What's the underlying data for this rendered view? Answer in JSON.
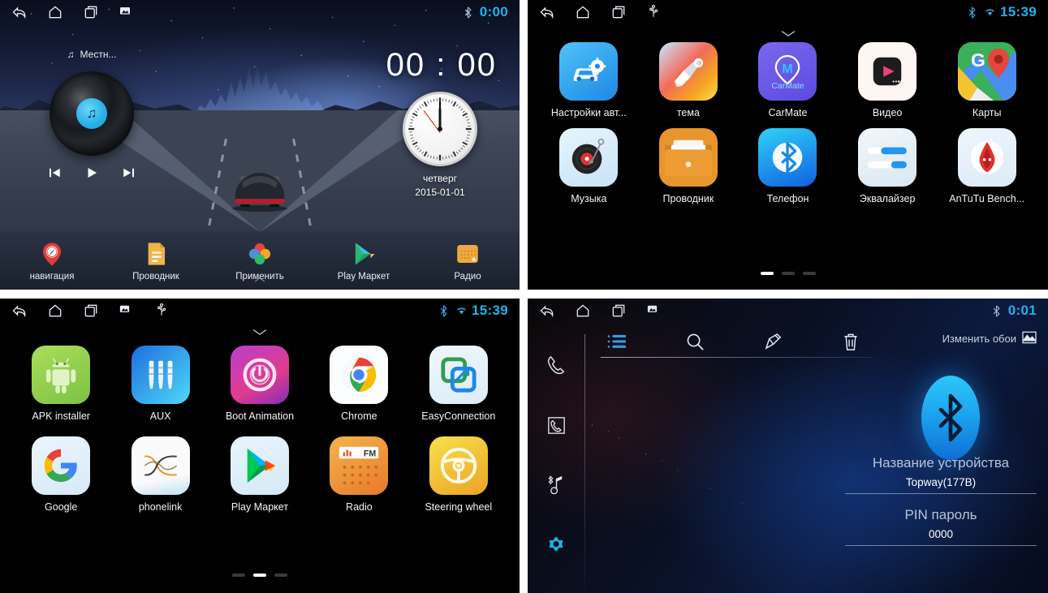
{
  "panels": {
    "home": {
      "name": "Car head unit home screen",
      "statusbar": {
        "icons": [
          "back-icon",
          "home-icon",
          "recents-icon",
          "screenshot-icon"
        ],
        "bluetooth": "bluetooth-icon",
        "clock": "0:00"
      },
      "music": {
        "source_label": "Местн...",
        "note_icon": "music-note-icon",
        "prev_label": "prev-track",
        "play_label": "play",
        "next_label": "next-track"
      },
      "digital_clock": "00 : 00",
      "weekday": "четверг",
      "date": "2015-01-01",
      "analog_clock": {
        "hour": 12,
        "minute": 0,
        "second": 50
      },
      "dock": [
        {
          "label": "навигация",
          "icon": "navigation-pin-icon"
        },
        {
          "label": "Проводник",
          "icon": "file-manager-icon"
        },
        {
          "label": "Применить",
          "icon": "apply-petals-icon"
        },
        {
          "label": "Play Маркет",
          "icon": "play-store-icon"
        },
        {
          "label": "Радио",
          "icon": "radio-icon"
        }
      ]
    },
    "apps1": {
      "name": "App drawer page 1",
      "statusbar": {
        "icons": [
          "back-icon",
          "home-icon",
          "recents-icon",
          "usb-icon"
        ],
        "bluetooth": "bluetooth-icon",
        "wifi": "wifi-icon",
        "clock": "15:39"
      },
      "chevron": "chevron-down-icon",
      "apps": [
        {
          "label": "Настройки авт...",
          "icon": "car-settings-icon"
        },
        {
          "label": "тема",
          "icon": "theme-brush-icon"
        },
        {
          "label": "CarMate",
          "icon": "carmate-icon",
          "inner_text": "CarMate"
        },
        {
          "label": "Видео",
          "icon": "video-player-icon"
        },
        {
          "label": "Карты",
          "icon": "google-maps-icon"
        },
        {
          "label": "Музыка",
          "icon": "music-vinyl-icon"
        },
        {
          "label": "Проводник",
          "icon": "file-explorer-icon"
        },
        {
          "label": "Телефон",
          "icon": "bluetooth-phone-icon"
        },
        {
          "label": "Эквалайзер",
          "icon": "equalizer-icon"
        },
        {
          "label": "AnTuTu Bench...",
          "icon": "antutu-icon"
        }
      ],
      "pages": {
        "count": 3,
        "active": 0
      }
    },
    "apps2": {
      "name": "App drawer page 2",
      "statusbar": {
        "icons": [
          "back-icon",
          "home-icon",
          "recents-icon",
          "screenshot-icon",
          "usb-icon"
        ],
        "bluetooth": "bluetooth-icon",
        "wifi": "wifi-icon",
        "clock": "15:39"
      },
      "chevron": "chevron-down-icon",
      "apps": [
        {
          "label": "APK installer",
          "icon": "android-robot-icon"
        },
        {
          "label": "AUX",
          "icon": "aux-jack-icon"
        },
        {
          "label": "Boot Animation",
          "icon": "power-boot-icon"
        },
        {
          "label": "Chrome",
          "icon": "chrome-icon"
        },
        {
          "label": "EasyConnection",
          "icon": "easyconnection-icon"
        },
        {
          "label": "Google",
          "icon": "google-g-icon"
        },
        {
          "label": "phonelink",
          "icon": "phonelink-icon"
        },
        {
          "label": "Play Маркет",
          "icon": "play-store-icon"
        },
        {
          "label": "Radio",
          "icon": "radio-fm-icon",
          "inner_text": "FM"
        },
        {
          "label": "Steering wheel",
          "icon": "steering-wheel-icon"
        }
      ],
      "pages": {
        "count": 3,
        "active": 1
      }
    },
    "bluetooth": {
      "name": "Bluetooth settings screen",
      "statusbar": {
        "icons": [
          "back-icon",
          "home-icon",
          "recents-icon",
          "screenshot-icon"
        ],
        "bluetooth": "bluetooth-icon",
        "clock": "0:01"
      },
      "sidebar": [
        {
          "icon": "dialpad-phone-icon",
          "active": false
        },
        {
          "icon": "contacts-icon",
          "active": false
        },
        {
          "icon": "bluetooth-music-icon",
          "active": false
        },
        {
          "icon": "settings-gear-icon",
          "active": true
        }
      ],
      "toolbar": [
        {
          "icon": "list-icon",
          "active": true
        },
        {
          "icon": "search-icon",
          "active": false
        },
        {
          "icon": "edit-pen-icon",
          "active": false
        },
        {
          "icon": "trash-icon",
          "active": false
        }
      ],
      "wallpaper_button": {
        "label": "Изменить обои",
        "icon": "wallpaper-image-icon"
      },
      "bt_logo_icon": "bluetooth-large-icon",
      "fields": [
        {
          "label": "Название устройства",
          "value": "Topway(177B)"
        },
        {
          "label": "PIN пароль",
          "value": "0000"
        }
      ]
    }
  },
  "colors": {
    "accent_cyan": "#1fb3e8",
    "bt_blue": "#1ca5ef",
    "panel_black": "#000000",
    "label_white": "#f2f4f8"
  }
}
